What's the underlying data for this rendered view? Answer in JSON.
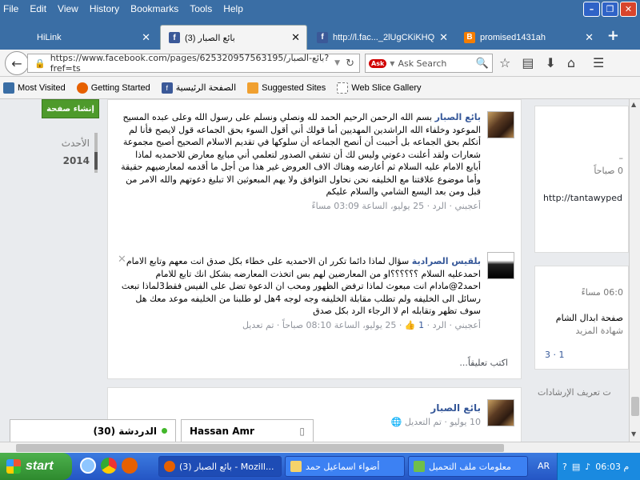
{
  "menubar": {
    "items": [
      "File",
      "Edit",
      "View",
      "History",
      "Bookmarks",
      "Tools",
      "Help"
    ]
  },
  "tabs": [
    {
      "label": "HiLink"
    },
    {
      "label": "بائع الصبار (3)"
    },
    {
      "label": "http://l.fac..._2lUgCKiKHQ"
    },
    {
      "label": "promised1431ah"
    }
  ],
  "nav": {
    "url": "https://www.facebook.com/pages/625320957563195/بائع-الصبار?fref=ts",
    "search_placeholder": "Ask Search",
    "ask_badge": "Ask"
  },
  "bookmarks": [
    "Most Visited",
    "Getting Started",
    "الصفحة الرئيسية",
    "Suggested Sites",
    "Web Slice Gallery"
  ],
  "left": {
    "create_page": "إنشاء صفحة",
    "recent": "الأحدث",
    "year": "2014"
  },
  "comments": [
    {
      "name": "بائع الصبار",
      "text": "بسم الله الرحمن الرحيم الحمد لله ونصلي ونسلم على رسول الله وعلى عبده المسيح الموعود وخلفاء الله الراشدين المهديين أما قولك أني أقول السوء بحق الجماعه قول لايصح فأنا لم أتكلم بحق الجماعه بل أحببت أن أنصح الجماعه أن سلوكها في تقديم الاسلام الصحيح أصبح مجموعة شعارات ولقد أعلنت دعوتي وليس لك أن تشقي الصدور لتعلمي أني مبايع معارض للاحمديه لماذا أبايع الامام عليه السلام ثم أعارضه وهناك الاف العروض غير هذا من أجل ما أقدمه لمعارضيهم حقيقة وأما موضوع علاقتنا مع الخليفه نحن نحاول التوافق ولا يهم المبعوثين الا تبليغ دعوتهم والله الامر من قبل ومن بعد اليسع الشامي والسلام عليكم",
      "meta": "أعجبني · الرد · 25 يوليو، الساعة 03:09 مساءً"
    },
    {
      "name": "بلقيس الصرادية",
      "text": "سؤال لماذا دائما تكرر ان الاحمديه على خطاء بكل صدق انت معهم وتابع الامام احمدعليه السلام ؟؟؟؟؟؟او من المعارضين لهم بس اتخذت المعارضه بشكل انك تابع للامام احمد2@مادام انت مبعوث لماذا ترفض الظهور ومحب ان الدعوة تضل على الفيس فقط3لماذا تبعث رسائل الى الخليفه ولم تطلب مقابلة الخليفه وجه لوجه 4هل لو طلبنا من الخليفه موعد معك هل سوف تظهر وتقابله ام لا الرجاء الرد بكل صدق",
      "meta_like": "أعجبني · الرد · ",
      "like_count": "1",
      "meta_time": " · 25 يوليو، الساعة 08:10 صباحاً · تم تعديل"
    }
  ],
  "write_comment": "اكتب تعليقاً...",
  "post2": {
    "name": "بائع الصبار",
    "meta": "10 يوليو · تم التعديل"
  },
  "right": {
    "box1_time": "0 صباحاً",
    "box1_link": "http://tantawyped",
    "box2_time": "06:0 مساءً",
    "box2_line1": "صفحة ابدال الشام",
    "box2_line2": "شهادة المزيد",
    "box2_counts": "3 · 1",
    "hints": "ت تعريف الإرشادات"
  },
  "chat": {
    "online": "(30) الدردشة",
    "friend": "Hassan Amr"
  },
  "taskbar": {
    "start": "start",
    "tasks": [
      "بائع الصبار (3) - Mozill...",
      "أضواء اسماعيل حمد",
      "معلومات ملف التحميل"
    ],
    "lang": "AR",
    "time": "06:03 م"
  }
}
